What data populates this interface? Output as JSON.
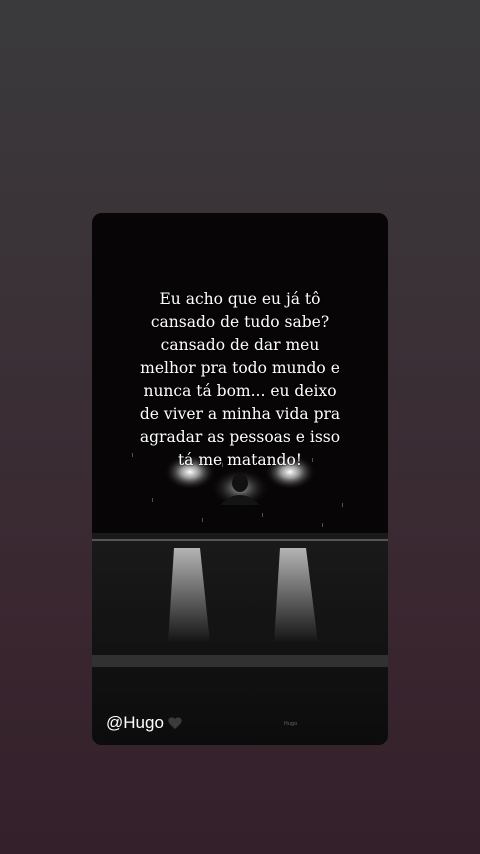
{
  "story": {
    "quote": "Eu acho que eu já tô\ncansado de tudo sabe?\ncansado de dar meu\nmelhor pra todo mundo e\nnunca tá bom... eu deixo\nde viver a minha vida pra\nagradar as pessoas e isso\ntá me matando!",
    "handle": "@Hugo",
    "handle_icon": "black-heart-icon",
    "watermark": "Hugo"
  }
}
